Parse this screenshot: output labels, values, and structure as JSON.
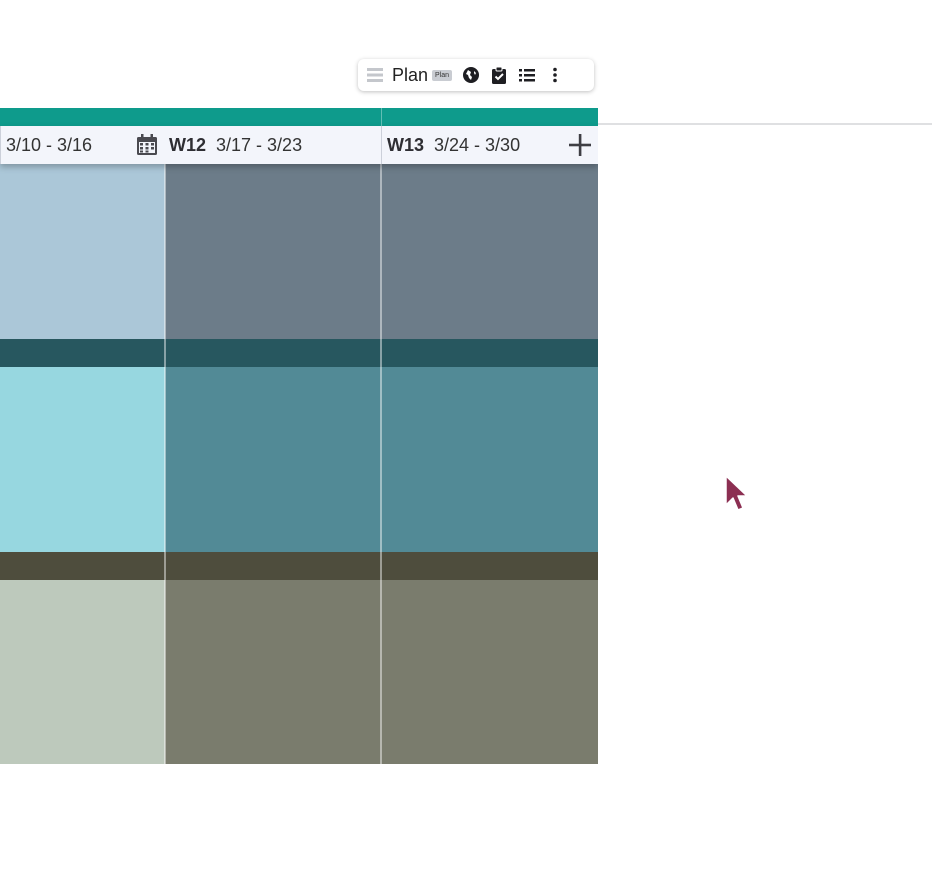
{
  "toolbar": {
    "title": "Plan",
    "badge": "Plan",
    "icons": [
      "board-view-icon",
      "globe-icon",
      "clipboard-check-icon",
      "list-icon",
      "more-vertical-icon"
    ]
  },
  "weeks": [
    {
      "label": "",
      "range": "3/10 - 3/16"
    },
    {
      "label": "W12",
      "range": "3/17 - 3/23"
    },
    {
      "label": "W13",
      "range": "3/24 - 3/30"
    }
  ],
  "colors": {
    "accent_teal": "#0e9b8c",
    "header_bg": "#f3f5fb",
    "row1_light": "#abc7d8",
    "row1_dark": "#6c7c89",
    "row1_strip": "#27575f",
    "row2_light": "#97d7e0",
    "row2_dark": "#528a96",
    "row2_strip": "#4e4d3d",
    "row3_light": "#bdc9bc",
    "row3_dark": "#7a7c6d",
    "cursor": "#8c2f52"
  }
}
